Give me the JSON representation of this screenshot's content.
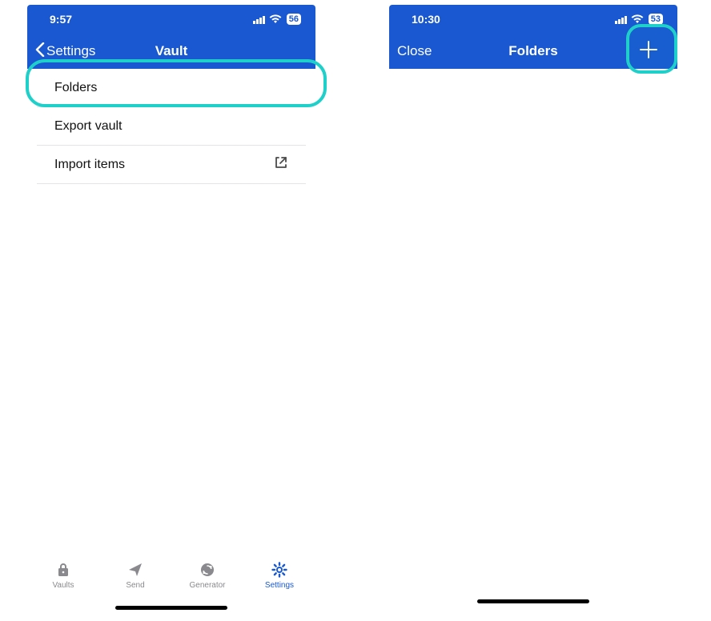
{
  "left": {
    "status": {
      "time": "9:57",
      "battery": "56"
    },
    "nav": {
      "back_label": "Settings",
      "title": "Vault"
    },
    "rows": {
      "folders": {
        "label": "Folders"
      },
      "export": {
        "label": "Export vault"
      },
      "import": {
        "label": "Import items"
      }
    },
    "tabs": {
      "vaults": {
        "label": "Vaults"
      },
      "send": {
        "label": "Send"
      },
      "generator": {
        "label": "Generator"
      },
      "settings": {
        "label": "Settings"
      }
    }
  },
  "right": {
    "status": {
      "time": "10:30",
      "battery": "53"
    },
    "nav": {
      "close_label": "Close",
      "title": "Folders"
    }
  },
  "colors": {
    "brand": "#1958d1",
    "highlight": "#1ed0c9"
  }
}
